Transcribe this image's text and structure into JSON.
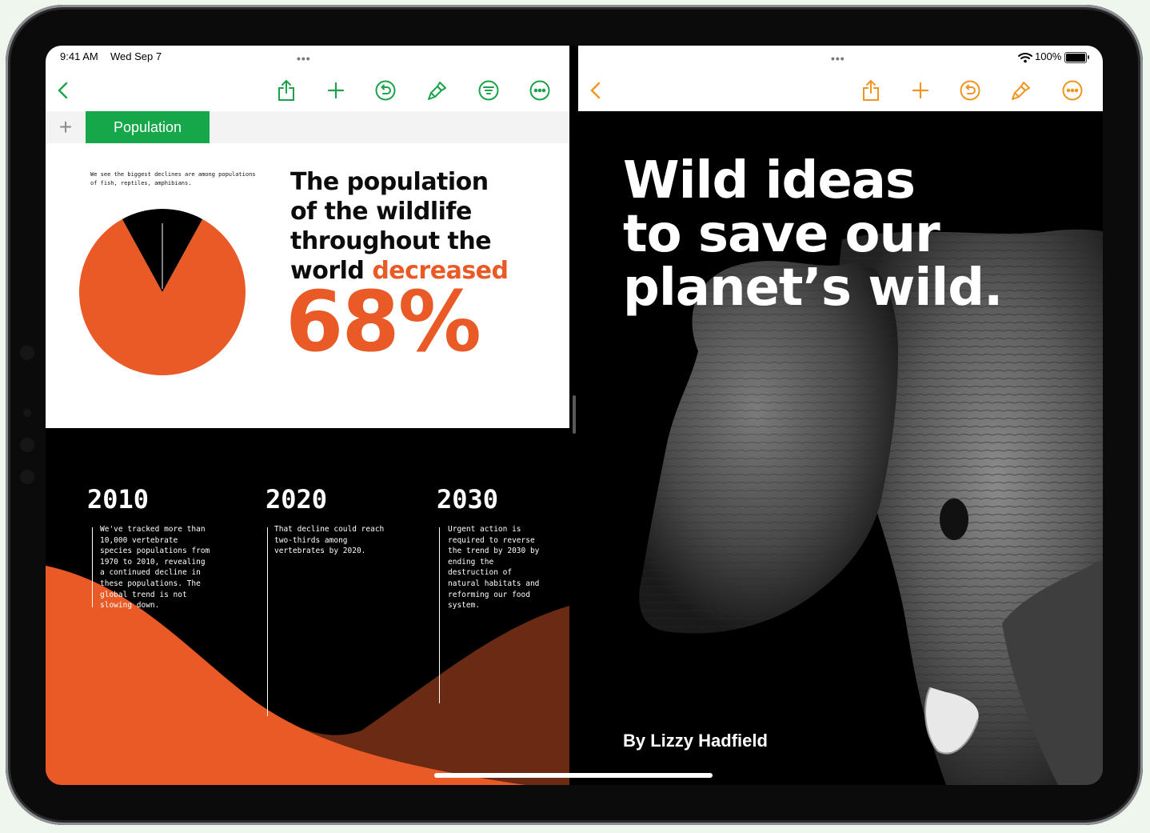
{
  "status": {
    "time": "9:41 AM",
    "date": "Wed Sep 7",
    "battery": "100%"
  },
  "left_app": {
    "toolbar_icons": [
      "back-chevron-icon",
      "share-icon",
      "add-icon",
      "undo-icon",
      "format-brush-icon",
      "organize-icon",
      "more-icon"
    ],
    "tab": {
      "add_label": "+",
      "active_tab": "Population"
    },
    "pie": {
      "note": "We see the biggest declines are among populations of fish, reptiles, amphibians.",
      "slices": [
        {
          "value": 84,
          "color": "#ea5a26"
        },
        {
          "value": 16,
          "color": "#000000"
        }
      ]
    },
    "headline": {
      "line1": "The population",
      "line2": "of the wildlife",
      "line3": "throughout the",
      "line4_prefix": "world ",
      "line4_accent": "decreased"
    },
    "big_number": "68%",
    "timeline": [
      {
        "year": "2010",
        "text": "We've tracked more than 10,000 vertebrate species populations from 1970 to 2010, revealing a continued decline in these populations. The global trend is not slowing down."
      },
      {
        "year": "2020",
        "text": "That decline could reach two-thirds among vertebrates by 2020."
      },
      {
        "year": "2030",
        "text": "Urgent action is required to reverse the trend by 2030 by ending the destruction of natural habitats and reforming our food system."
      }
    ],
    "colors": {
      "accent": "#ea5a26",
      "tab_green": "#16a74a",
      "dark_orange": "#6b2a14"
    }
  },
  "right_app": {
    "toolbar_icons": [
      "back-chevron-icon",
      "share-icon",
      "add-icon",
      "undo-icon",
      "format-brush-icon",
      "more-icon"
    ],
    "title": {
      "line1": "Wild ideas",
      "line2": "to save our",
      "line3": "planet’s wild."
    },
    "byline": "By Lizzy Hadfield",
    "accent": "#f0951f"
  }
}
